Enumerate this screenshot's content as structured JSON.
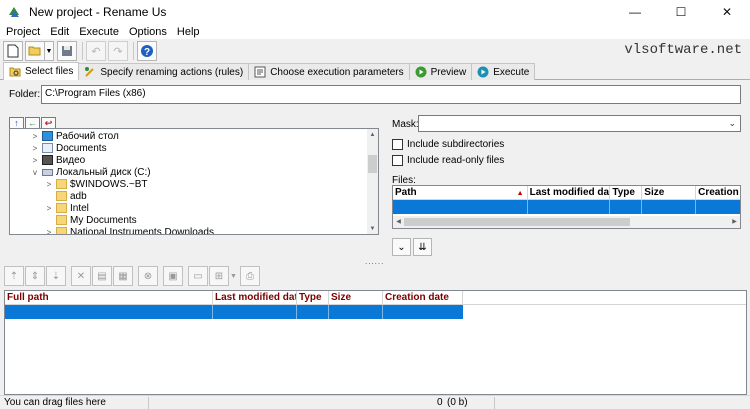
{
  "window": {
    "title": "New project - Rename Us",
    "minimize": "—",
    "maximize": "☐",
    "close": "✕"
  },
  "menu": [
    "Project",
    "Edit",
    "Execute",
    "Options",
    "Help"
  ],
  "brand": "vlsoftware.net",
  "tabs": [
    {
      "label": "Select files",
      "icon": "folder-icon"
    },
    {
      "label": "Specify renaming actions (rules)",
      "icon": "rules-icon"
    },
    {
      "label": "Choose execution parameters",
      "icon": "params-icon"
    },
    {
      "label": "Preview",
      "icon": "play-icon"
    },
    {
      "label": "Execute",
      "icon": "execute-icon"
    }
  ],
  "folder": {
    "label": "Folder:",
    "value": "C:\\Program Files (x86)"
  },
  "tree": {
    "items": [
      {
        "label": "Рабочий стол",
        "expander": ">",
        "icon": "desktop-icon"
      },
      {
        "label": "Documents",
        "expander": ">",
        "icon": "documents-icon"
      },
      {
        "label": "Видео",
        "expander": ">",
        "icon": "video-icon"
      },
      {
        "label": "Локальный диск (C:)",
        "expander": "v",
        "icon": "drive-icon"
      },
      {
        "label": "$WINDOWS.~BT",
        "expander": ">",
        "icon": "folder-icon"
      },
      {
        "label": "adb",
        "expander": "",
        "icon": "folder-icon"
      },
      {
        "label": "Intel",
        "expander": ">",
        "icon": "folder-icon"
      },
      {
        "label": "My Documents",
        "expander": "",
        "icon": "folder-icon"
      },
      {
        "label": "National Instruments Downloads",
        "expander": ">",
        "icon": "folder-icon"
      }
    ]
  },
  "mask": {
    "label": "Mask:",
    "value": ""
  },
  "options": {
    "include_subdirectories": {
      "label": "Include subdirectories",
      "checked": false
    },
    "include_readonly": {
      "label": "Include read-only files",
      "checked": false
    }
  },
  "files": {
    "label": "Files:",
    "columns": [
      "Path",
      "Last modified date",
      "Type",
      "Size",
      "Creation d"
    ]
  },
  "list": {
    "columns": [
      "Full path",
      "Last modified date",
      "Type",
      "Size",
      "Creation date"
    ]
  },
  "status": {
    "hint": "You can drag files here",
    "count": "0",
    "size": "(0 b)"
  },
  "colors": {
    "selection": "#0a78d7",
    "header_text": "#7a0000",
    "sort_indicator": "#c00000"
  }
}
